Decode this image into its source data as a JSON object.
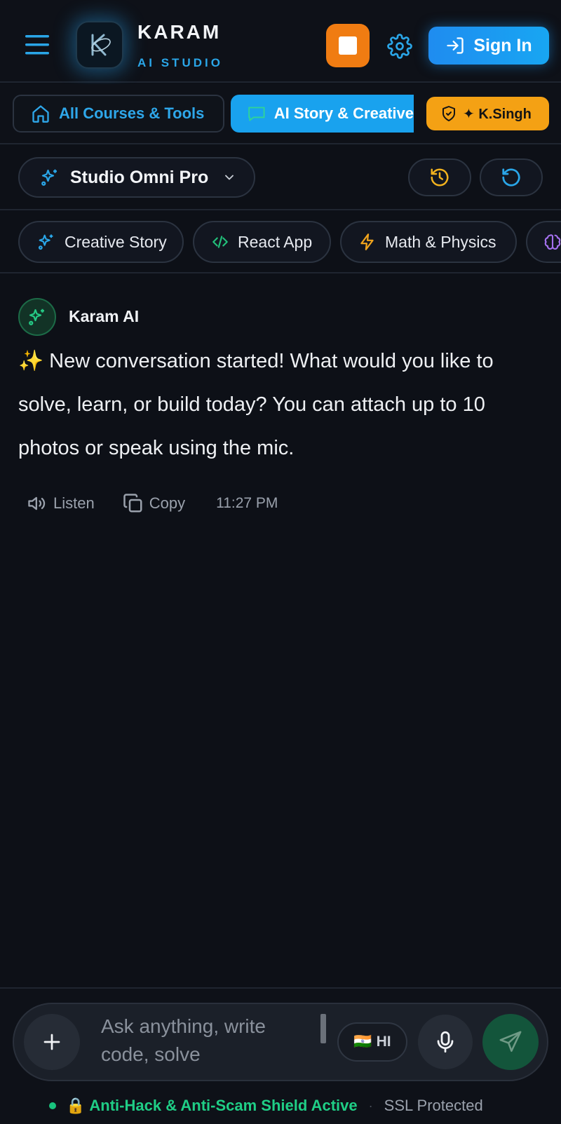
{
  "header": {
    "brand_name": "KARAM",
    "brand_sub": "AI STUDIO",
    "signin_label": "Sign In"
  },
  "nav": {
    "tabs": [
      {
        "label": "All Courses & Tools"
      },
      {
        "label": "AI Story & Creative"
      },
      {
        "label": "✦ K.Singh"
      }
    ]
  },
  "model": {
    "selected": "Studio Omni Pro"
  },
  "chips": [
    {
      "label": "Creative Story",
      "icon": "sparkles-icon"
    },
    {
      "label": "React App",
      "icon": "code-icon"
    },
    {
      "label": "Math & Physics",
      "icon": "lightning-icon"
    },
    {
      "label": "",
      "icon": "brain-icon"
    }
  ],
  "message": {
    "sender": "Karam AI",
    "text": "✨ New conversation started! What would you like to solve, learn, or build today? You can attach up to 10 photos or speak using the mic.",
    "actions": {
      "listen": "Listen",
      "copy": "Copy"
    },
    "time": "11:27 PM"
  },
  "composer": {
    "placeholder": "Ask anything, write code, solve",
    "lang_flag": "🇮🇳",
    "lang": "HI"
  },
  "footer": {
    "lock": "🔒",
    "shield": "Anti-Hack & Anti-Scam Shield Active",
    "separator": "·",
    "ssl": "SSL Protected"
  },
  "colors": {
    "background": "#0d1017",
    "accent_blue": "#19a2ee",
    "accent_orange": "#f07c12",
    "badge_gold": "#f4a114",
    "shield_green": "#1fce86"
  }
}
